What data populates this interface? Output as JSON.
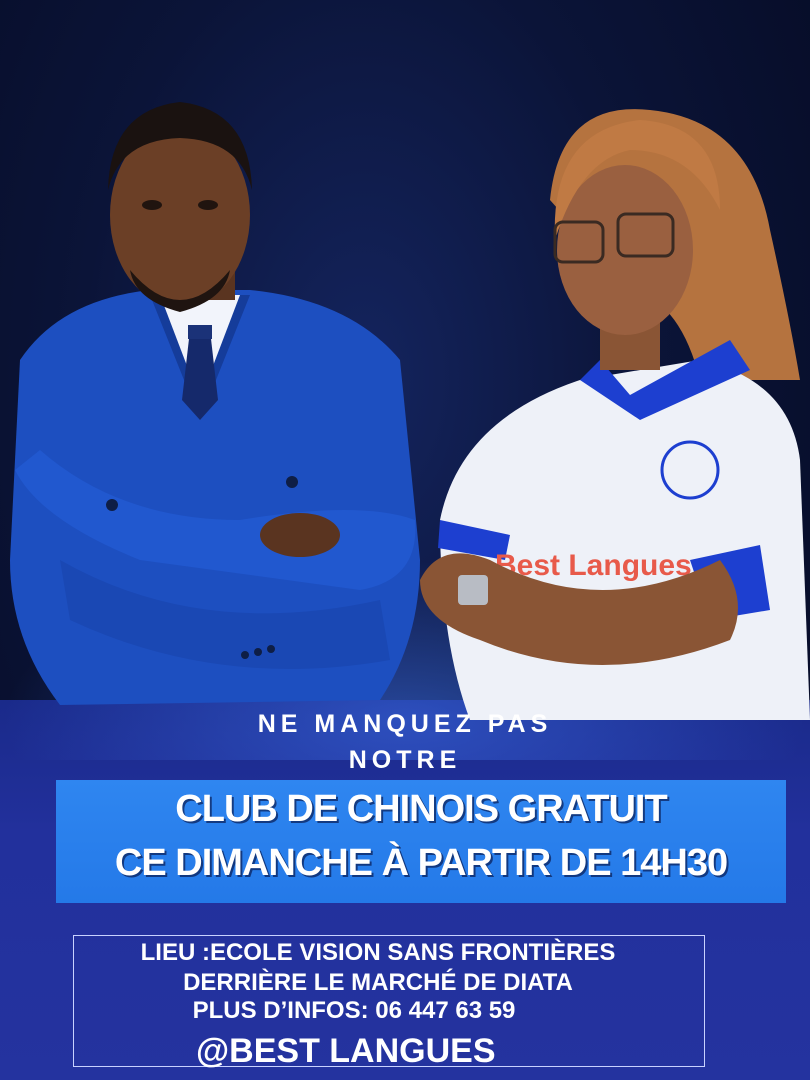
{
  "poster": {
    "tagline_line1": "NE MANQUEZ PAS",
    "tagline_line2": "NOTRE",
    "headline_line1": "CLUB DE CHINOIS GRATUIT",
    "headline_line2": "CE DIMANCHE  À PARTIR DE 14H30",
    "location": "LIEU :ECOLE VISION SANS FRONTIÈRES",
    "location_detail": "DERRIÈRE LE MARCHÉ DE DIATA",
    "contact": "PLUS D’INFOS: 06 447 63 59",
    "handle": "@BEST LANGUES",
    "shirt_print": "Best Langues"
  },
  "colors": {
    "background": "#0b1438",
    "banner": "#2a80ed",
    "lower_band": "#22309c",
    "suit": "#1d4fc0",
    "text": "#ffffff"
  }
}
